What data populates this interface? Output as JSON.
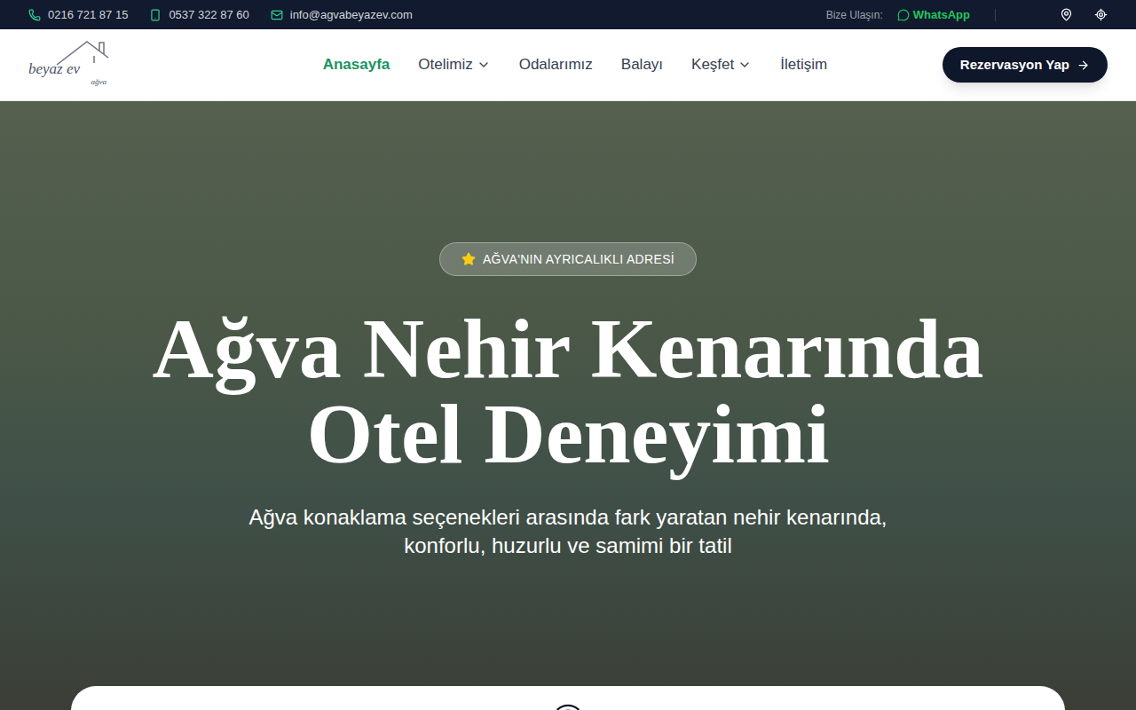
{
  "topbar": {
    "phone": "0216 721 87 15",
    "mobile": "0537 322 87 60",
    "email": "info@agvabeyazev.com",
    "contact_label": "Bize Ulaşın:",
    "whatsapp": "WhatsApp"
  },
  "logo": {
    "name": "beyaz ev",
    "place": "ağva"
  },
  "nav": [
    {
      "label": "Anasayfa",
      "selected": true,
      "dropdown": false
    },
    {
      "label": "Otelimiz",
      "selected": false,
      "dropdown": true
    },
    {
      "label": "Odalarımız",
      "selected": false,
      "dropdown": false
    },
    {
      "label": "Balayı",
      "selected": false,
      "dropdown": false
    },
    {
      "label": "Keşfet",
      "selected": false,
      "dropdown": true
    },
    {
      "label": "İletişim",
      "selected": false,
      "dropdown": false
    }
  ],
  "cta": "Rezervasyon Yap",
  "hero": {
    "badge": "AĞVA'NIN AYRICALIKLI ADRESİ",
    "title_lines": [
      "Ağva Nehir Kenarında",
      "Otel Deneyimi"
    ],
    "subtitle_lines": [
      "Ağva konaklama seçenekleri arasında fark yaratan nehir kenarında,",
      "konforlu, huzurlu ve samimi bir tatil"
    ]
  }
}
